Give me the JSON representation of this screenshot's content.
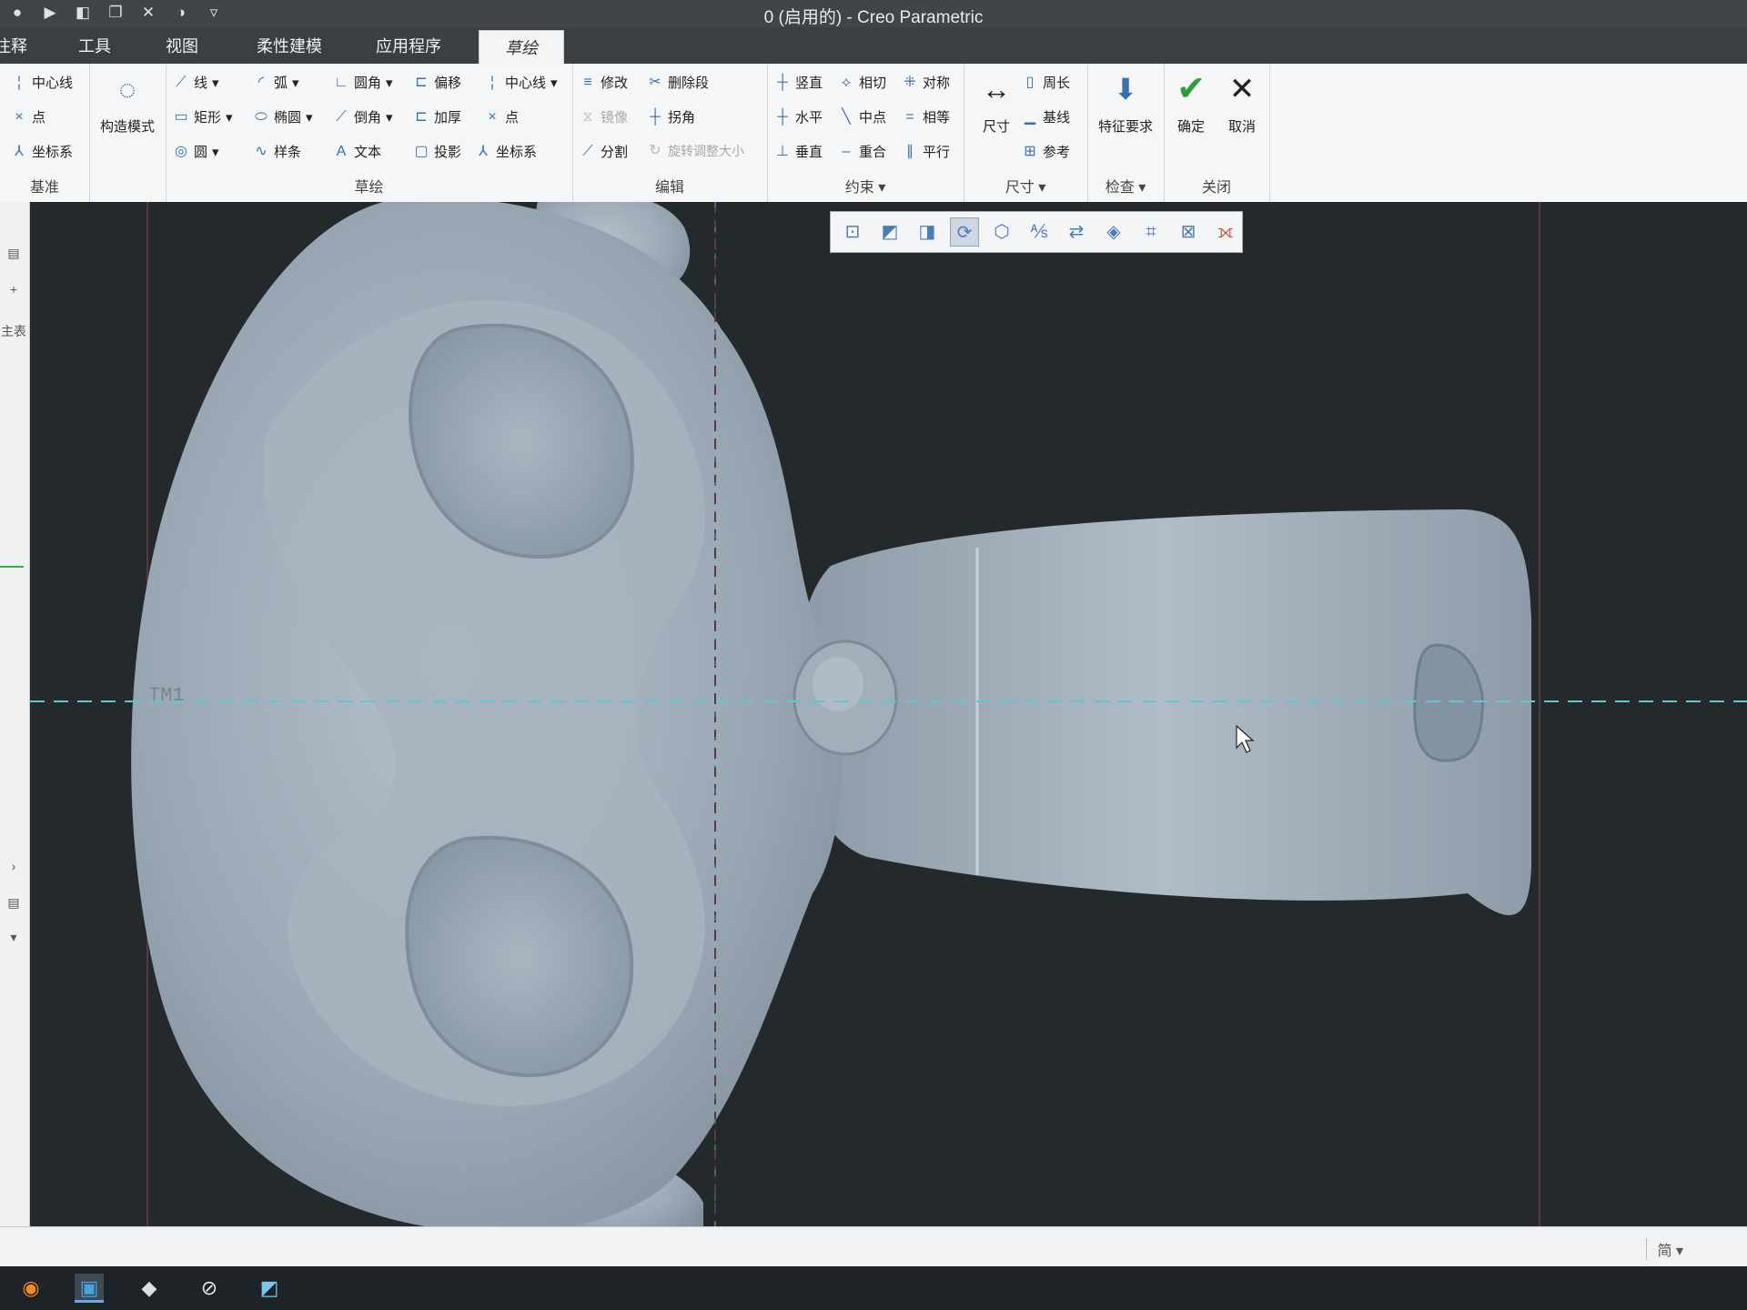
{
  "window": {
    "title": "0 (启用的) - Creo Parametric",
    "qat_icons": [
      "new-icon",
      "open-icon",
      "save-icon",
      "windows-icon",
      "close-icon",
      "appearance-icon",
      "customize-icon"
    ]
  },
  "tabs": [
    {
      "label": "注释"
    },
    {
      "label": "工具"
    },
    {
      "label": "视图"
    },
    {
      "label": "柔性建模"
    },
    {
      "label": "应用程序"
    },
    {
      "label": "草绘",
      "active": true
    }
  ],
  "ribbon": {
    "datum": {
      "title": "基准",
      "centerline": "中心线",
      "point": "点",
      "csys": "坐标系"
    },
    "construction": {
      "label": "构造模式"
    },
    "sketch": {
      "title": "草绘",
      "line": "线",
      "arc": "弧",
      "fillet": "圆角",
      "offset": "偏移",
      "centerline": "中心线",
      "rectangle": "矩形",
      "ellipse": "椭圆",
      "chamfer": "倒角",
      "thicken": "加厚",
      "point": "点",
      "circle": "圆",
      "spline": "样条",
      "text": "文本",
      "project": "投影",
      "csys": "坐标系"
    },
    "edit": {
      "title": "编辑",
      "modify": "修改",
      "delete_segment": "删除段",
      "mirror": "镜像",
      "corner": "拐角",
      "divide": "分割",
      "rotate_resize": "旋转调整大小"
    },
    "constrain": {
      "title": "约束",
      "vertical": "竖直",
      "tangent": "相切",
      "symmetric": "对称",
      "horizontal": "水平",
      "midpoint": "中点",
      "equal": "相等",
      "perpendicular": "垂直",
      "coincident": "重合",
      "parallel": "平行"
    },
    "dimension": {
      "title": "尺寸",
      "dimension": "尺寸",
      "perimeter": "周长",
      "baseline": "基线",
      "reference": "参考"
    },
    "inspect": {
      "title": "检查",
      "feature_req": "特征要求"
    },
    "close": {
      "title": "关闭",
      "ok": "确定",
      "cancel": "取消"
    }
  },
  "left_panel": {
    "label": "主表"
  },
  "viewport": {
    "csys_label": "TM1",
    "view_toolbar_icons": [
      "refit-icon",
      "zoom-in-icon",
      "zoom-out-icon",
      "repaint-icon",
      "display-style-icon",
      "saved-orientation-icon",
      "view-manager-icon",
      "perspective-icon",
      "sketch-view-icon",
      "datum-display-icon",
      "sketcher-display-icon"
    ]
  },
  "status": {
    "input_indicator": "简"
  },
  "taskbar_icons": [
    "blender-icon",
    "creo-icon",
    "app-icon",
    "sketch-app-icon",
    "notes-icon"
  ],
  "colors": {
    "model": "#9ba8b4",
    "background": "#242a2b",
    "ribbon": "#f5f6f7",
    "accent": "#3a6fb0",
    "centerline": "#5ec8d0"
  }
}
